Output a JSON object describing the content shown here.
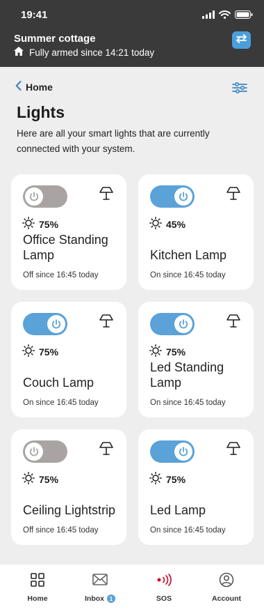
{
  "status_bar": {
    "time": "19:41"
  },
  "header": {
    "site_name": "Summer cottage",
    "arm_status": "Fully armed since 14:21 today"
  },
  "nav": {
    "back_label": "Home"
  },
  "page": {
    "title": "Lights",
    "description": "Here are all your smart lights that are currently connected with your system."
  },
  "lights": [
    {
      "name": "Office Standing Lamp",
      "brightness": "75%",
      "state": "off",
      "status": "Off since 16:45 today"
    },
    {
      "name": "Kitchen Lamp",
      "brightness": "45%",
      "state": "on",
      "status": "On since 16:45 today"
    },
    {
      "name": "Couch Lamp",
      "brightness": "75%",
      "state": "on",
      "status": "On since 16:45 today"
    },
    {
      "name": "Led Standing Lamp",
      "brightness": "75%",
      "state": "on",
      "status": "On since 16:45 today"
    },
    {
      "name": "Ceiling Lightstrip",
      "brightness": "75%",
      "state": "off",
      "status": "Off since 16:45 today"
    },
    {
      "name": "Led Lamp",
      "brightness": "75%",
      "state": "on",
      "status": "On since 16:45 today"
    }
  ],
  "bottom_nav": {
    "home": "Home",
    "inbox": "Inbox",
    "inbox_badge": "1",
    "sos": "SOS",
    "account": "Account"
  },
  "colors": {
    "header_bg": "#3a3a3a",
    "accent_blue": "#5aa2d8",
    "toggle_off": "#a9a4a3",
    "sos_red": "#c8102e",
    "page_bg": "#efeeee"
  }
}
